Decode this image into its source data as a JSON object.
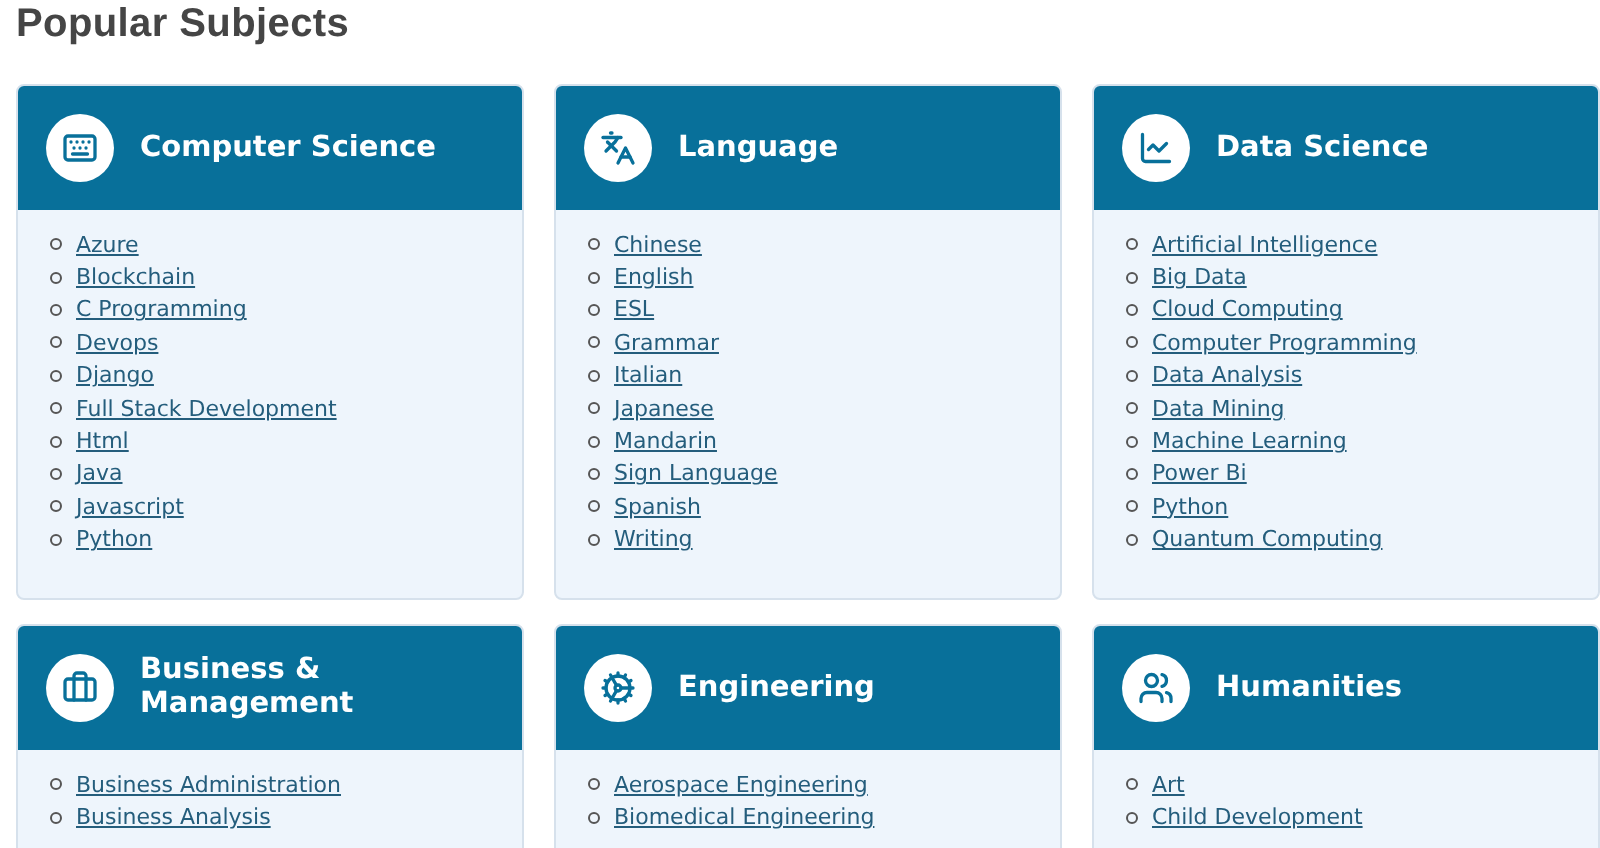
{
  "heading": "Popular Subjects",
  "subjects": [
    {
      "title": "Computer Science",
      "links": [
        "Azure",
        "Blockchain",
        "C Programming",
        "Devops",
        "Django",
        "Full Stack Development",
        "Html",
        "Java",
        "Javascript",
        "Python"
      ]
    },
    {
      "title": "Language",
      "links": [
        "Chinese",
        "English",
        "ESL",
        "Grammar",
        "Italian",
        "Japanese",
        "Mandarin",
        "Sign Language",
        "Spanish",
        "Writing"
      ]
    },
    {
      "title": "Data Science",
      "links": [
        "Artificial Intelligence",
        "Big Data",
        "Cloud Computing",
        "Computer Programming",
        "Data Analysis",
        "Data Mining",
        "Machine Learning",
        "Power Bi",
        "Python",
        "Quantum Computing"
      ]
    },
    {
      "title": "Business & Management",
      "links": [
        "Business Administration",
        "Business Analysis"
      ]
    },
    {
      "title": "Engineering",
      "links": [
        "Aerospace Engineering",
        "Biomedical Engineering"
      ]
    },
    {
      "title": "Humanities",
      "links": [
        "Art",
        "Child Development"
      ]
    }
  ]
}
